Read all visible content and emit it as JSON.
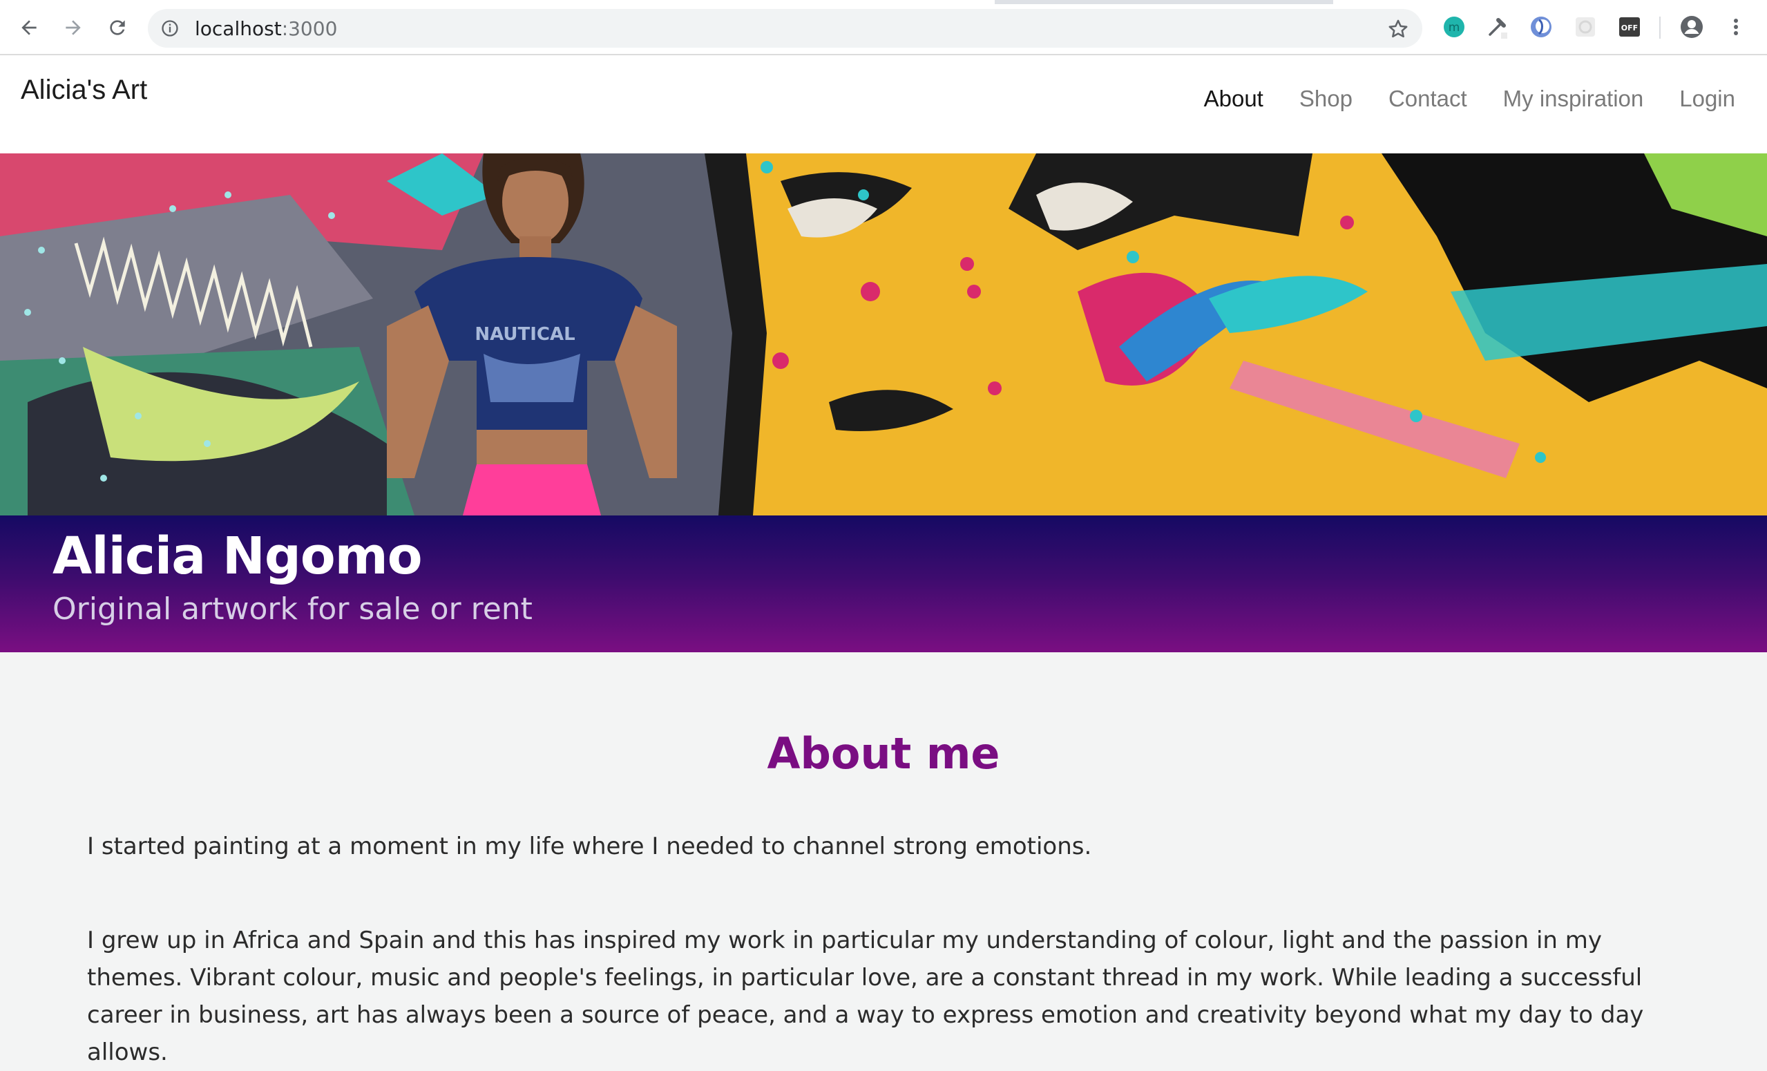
{
  "browser": {
    "url_host": "localhost",
    "url_port": ":3000",
    "icons": [
      "back-arrow-icon",
      "forward-arrow-icon",
      "reload-icon",
      "info-icon",
      "bookmark-star-icon",
      "extension-m-icon",
      "eyedropper-icon",
      "extension-blue-icon",
      "extension-grey-icon",
      "extension-off-icon",
      "profile-icon",
      "more-vert-icon"
    ],
    "extension_off_label": "OFF",
    "extension_m_label": "m"
  },
  "site": {
    "brand": "Alicia's Art",
    "nav": [
      {
        "label": "About",
        "active": true
      },
      {
        "label": "Shop",
        "active": false
      },
      {
        "label": "Contact",
        "active": false
      },
      {
        "label": "My inspiration",
        "active": false
      },
      {
        "label": "Login",
        "active": false
      }
    ]
  },
  "hero": {
    "name": "Alicia Ngomo",
    "tagline": "Original artwork for sale or rent",
    "shirt_text": "NAUTICAL"
  },
  "about": {
    "heading": "About me",
    "paragraphs": [
      "I started painting at a moment in my life where I needed to channel strong emotions.",
      "I grew up in Africa and Spain and this has inspired my work in particular my understanding of colour, light and the passion in my themes. Vibrant colour, music and people's feelings, in particular love, are a constant thread in my work. While leading a successful career in business, art has always been a source of peace, and a way to express emotion and creativity beyond what my day to day allows."
    ]
  },
  "colors": {
    "accent": "#7a0e82",
    "banner_top": "#150a63",
    "banner_bottom": "#7a0e82",
    "page_bg": "#f3f4f4"
  }
}
